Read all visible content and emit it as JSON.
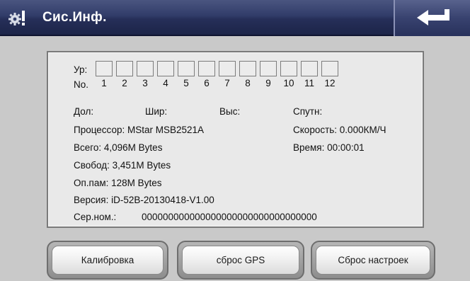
{
  "header": {
    "title": "Сис.Инф.",
    "settings_icon": "gear-icon",
    "back_icon": "return-arrow-icon"
  },
  "satellites": {
    "level_label": "Ур:",
    "number_label": "No.",
    "numbers": [
      "1",
      "2",
      "3",
      "4",
      "5",
      "6",
      "7",
      "8",
      "9",
      "10",
      "11",
      "12"
    ]
  },
  "info": {
    "lon": "Дол:",
    "lat": "Шир:",
    "alt": "Выс:",
    "sats": "Спутн:",
    "processor": "Процессор: MStar MSB2521A",
    "speed": "Скорость: 0.000КМ/Ч",
    "total": "Всего:  4,096M Bytes",
    "time": "Время: 00:00:01",
    "free": "Свобод:  3,451M Bytes",
    "ram": "Оп.пам:  128M Bytes",
    "version": "Версия: iD-52B-20130418-V1.00",
    "serial_label": "Сер.ном.:",
    "serial_value": "000000000000000000000000000000000"
  },
  "buttons": {
    "calibrate": "Калибровка",
    "reset_gps": "сброс GPS",
    "reset_settings": "Сброс настроек"
  }
}
